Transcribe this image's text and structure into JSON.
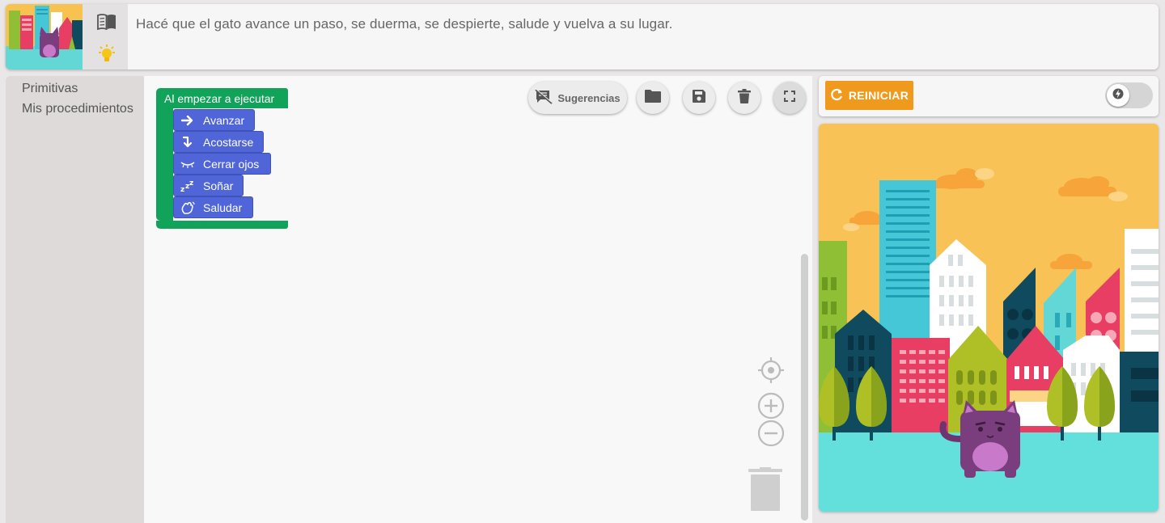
{
  "instructions": {
    "text": "Hacé que el gato avance un paso, se duerma, se despierte, salude y vuelva a su lugar."
  },
  "toolbox": {
    "categories": [
      "Primitivas",
      "Mis procedimientos"
    ]
  },
  "workspace": {
    "suggestions_label": "Sugerencias",
    "hat_block_label": "Al empezar a ejecutar",
    "blocks": [
      {
        "label": "Avanzar",
        "icon": "arrow-right-icon"
      },
      {
        "label": "Acostarse",
        "icon": "lie-down-icon"
      },
      {
        "label": "Cerrar ojos",
        "icon": "closed-eye-icon"
      },
      {
        "label": "Soñar",
        "icon": "zzz-icon"
      },
      {
        "label": "Saludar",
        "icon": "wave-hand-icon"
      }
    ]
  },
  "controls": {
    "reset_label": "REINICIAR",
    "accent_color": "#ef9a1c",
    "block_color": "#4f65d8",
    "hat_color": "#11a35a"
  }
}
